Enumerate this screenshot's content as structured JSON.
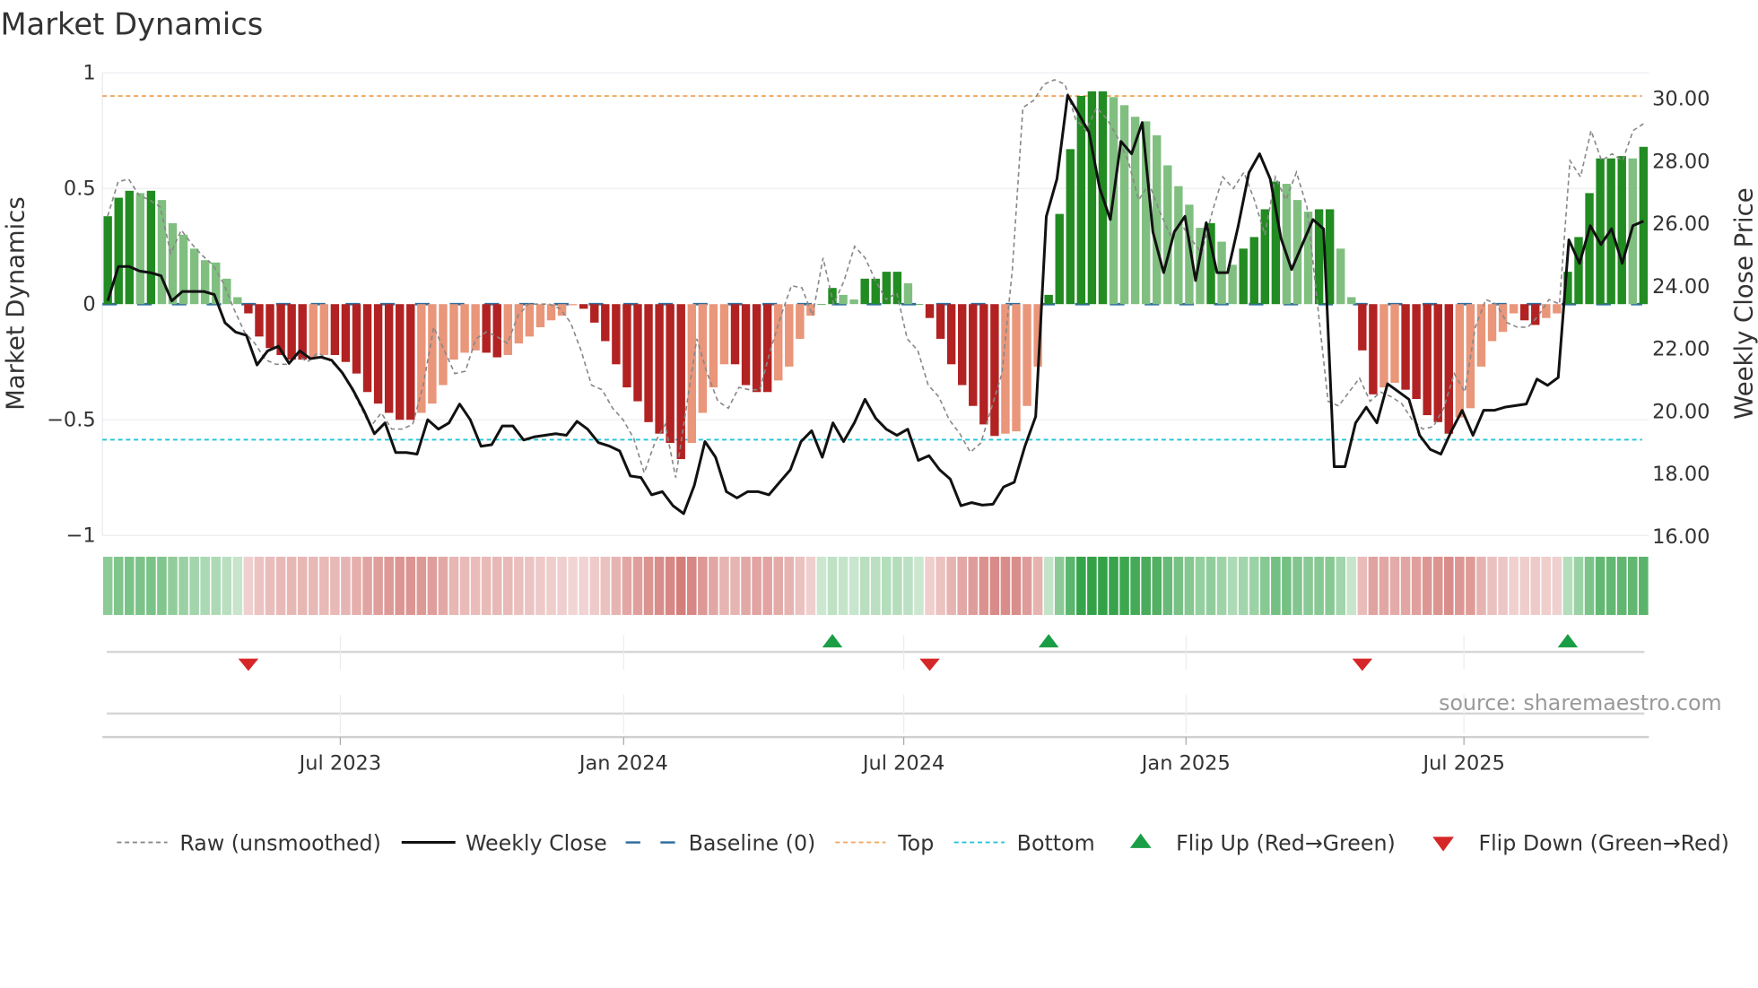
{
  "chart_data": {
    "type": "bar",
    "title": "Market Dynamics",
    "ylabel": "Market Dynamics",
    "y2label": "Weekly Close Price",
    "ylim": [
      -1,
      1
    ],
    "y2lim": [
      16,
      30.79
    ],
    "yticks": [
      {
        "v": 1,
        "label": "1"
      },
      {
        "v": 0.5,
        "label": "0.5"
      },
      {
        "v": 0,
        "label": "0"
      },
      {
        "v": -0.5,
        "label": "−0.5"
      },
      {
        "v": -1,
        "label": "−1"
      }
    ],
    "y2ticks": [
      {
        "v": 30,
        "label": "30.00"
      },
      {
        "v": 28,
        "label": "28.00"
      },
      {
        "v": 26,
        "label": "26.00"
      },
      {
        "v": 24,
        "label": "24.00"
      },
      {
        "v": 22,
        "label": "22.00"
      },
      {
        "v": 20,
        "label": "20.00"
      },
      {
        "v": 18,
        "label": "18.00"
      },
      {
        "v": 16,
        "label": "16.00"
      }
    ],
    "xticks": [
      {
        "week": 21.5,
        "label": "Jul 2023"
      },
      {
        "week": 47.7,
        "label": "Jan 2024"
      },
      {
        "week": 73.6,
        "label": "Jul 2024"
      },
      {
        "week": 99.7,
        "label": "Jan 2025"
      },
      {
        "week": 125.4,
        "label": "Jul 2025"
      }
    ],
    "top_level": 0.9,
    "bottom_level": -0.586,
    "baseline": 0,
    "market_dynamics": [
      0.38,
      0.46,
      0.49,
      0.48,
      0.49,
      0.45,
      0.35,
      0.3,
      0.24,
      0.19,
      0.18,
      0.11,
      0.03,
      -0.04,
      -0.14,
      -0.19,
      -0.22,
      -0.24,
      -0.24,
      -0.23,
      -0.22,
      -0.22,
      -0.25,
      -0.3,
      -0.38,
      -0.43,
      -0.47,
      -0.5,
      -0.5,
      -0.47,
      -0.43,
      -0.35,
      -0.24,
      -0.21,
      -0.2,
      -0.21,
      -0.23,
      -0.22,
      -0.17,
      -0.14,
      -0.1,
      -0.07,
      -0.05,
      -0.005,
      -0.02,
      -0.08,
      -0.16,
      -0.26,
      -0.36,
      -0.42,
      -0.51,
      -0.56,
      -0.6,
      -0.67,
      -0.6,
      -0.47,
      -0.36,
      -0.26,
      -0.26,
      -0.35,
      -0.38,
      -0.38,
      -0.33,
      -0.27,
      -0.15,
      -0.05,
      0.0,
      0.07,
      0.04,
      0.02,
      0.11,
      0.11,
      0.14,
      0.14,
      0.09,
      0.0,
      -0.06,
      -0.15,
      -0.26,
      -0.35,
      -0.44,
      -0.52,
      -0.57,
      -0.56,
      -0.55,
      -0.44,
      -0.27,
      0.04,
      0.39,
      0.67,
      0.9,
      0.92,
      0.92,
      0.895,
      0.86,
      0.81,
      0.79,
      0.73,
      0.6,
      0.51,
      0.43,
      0.33,
      0.35,
      0.27,
      0.17,
      0.24,
      0.29,
      0.41,
      0.53,
      0.52,
      0.45,
      0.4,
      0.41,
      0.41,
      0.24,
      0.03,
      -0.2,
      -0.39,
      -0.36,
      -0.34,
      -0.37,
      -0.41,
      -0.48,
      -0.51,
      -0.56,
      -0.49,
      -0.45,
      -0.27,
      -0.16,
      -0.12,
      -0.04,
      -0.07,
      -0.09,
      -0.06,
      -0.04,
      0.14,
      0.29,
      0.48,
      0.63,
      0.63,
      0.64,
      0.63,
      0.68
    ],
    "raw_unsmoothed": [
      0.38,
      0.53,
      0.54,
      0.47,
      0.45,
      0.42,
      0.22,
      0.32,
      0.26,
      0.21,
      0.17,
      0.09,
      -0.02,
      -0.12,
      -0.17,
      -0.24,
      -0.26,
      -0.26,
      -0.22,
      -0.25,
      -0.21,
      -0.24,
      -0.28,
      -0.35,
      -0.44,
      -0.53,
      -0.47,
      -0.54,
      -0.54,
      -0.52,
      -0.35,
      -0.1,
      -0.2,
      -0.3,
      -0.29,
      -0.15,
      -0.12,
      -0.14,
      -0.17,
      -0.05,
      0.0,
      0.0,
      0.0,
      -0.02,
      -0.08,
      -0.2,
      -0.35,
      -0.37,
      -0.45,
      -0.5,
      -0.58,
      -0.73,
      -0.6,
      -0.52,
      -0.75,
      -0.45,
      -0.15,
      -0.3,
      -0.42,
      -0.45,
      -0.36,
      -0.37,
      -0.37,
      -0.2,
      -0.05,
      0.08,
      0.07,
      -0.05,
      0.2,
      0.0,
      0.1,
      0.25,
      0.2,
      0.1,
      0.02,
      0.05,
      -0.15,
      -0.2,
      -0.35,
      -0.4,
      -0.5,
      -0.56,
      -0.64,
      -0.6,
      -0.45,
      -0.3,
      0.15,
      0.85,
      0.88,
      0.95,
      0.97,
      0.95,
      0.8,
      0.75,
      0.85,
      0.8,
      0.72,
      0.62,
      0.45,
      0.52,
      0.4,
      0.3,
      0.35,
      0.28,
      0.22,
      0.4,
      0.55,
      0.5,
      0.57,
      0.45,
      0.3,
      0.55,
      0.45,
      0.57,
      0.42,
      0.0,
      -0.42,
      -0.44,
      -0.38,
      -0.32,
      -0.42,
      -0.38,
      -0.4,
      -0.43,
      -0.5,
      -0.54,
      -0.53,
      -0.45,
      -0.3,
      -0.38,
      -0.1,
      0.02,
      0.0,
      -0.08,
      -0.1,
      -0.1,
      -0.05,
      0.02,
      0.0,
      0.62,
      0.55,
      0.75,
      0.62,
      0.65,
      0.62,
      0.75,
      0.78
    ],
    "weekly_close": [
      23.5,
      24.6,
      24.6,
      24.45,
      24.4,
      24.3,
      23.5,
      23.8,
      23.8,
      23.8,
      23.7,
      22.8,
      22.5,
      22.4,
      21.45,
      21.9,
      22.05,
      21.5,
      21.9,
      21.65,
      21.7,
      21.6,
      21.2,
      20.65,
      20.0,
      19.25,
      19.6,
      18.65,
      18.65,
      18.6,
      19.7,
      19.4,
      19.6,
      20.2,
      19.7,
      18.85,
      18.9,
      19.5,
      19.5,
      19.05,
      19.15,
      19.2,
      19.25,
      19.2,
      19.65,
      19.4,
      18.97,
      18.86,
      18.7,
      17.9,
      17.85,
      17.3,
      17.4,
      16.95,
      16.7,
      17.6,
      19.0,
      18.5,
      17.4,
      17.2,
      17.4,
      17.4,
      17.3,
      17.7,
      18.1,
      19.0,
      19.35,
      18.5,
      19.6,
      19.0,
      19.6,
      20.35,
      19.75,
      19.4,
      19.2,
      19.4,
      18.4,
      18.55,
      18.1,
      17.8,
      16.95,
      17.05,
      16.97,
      17.0,
      17.55,
      17.7,
      18.85,
      19.8,
      26.2,
      27.4,
      30.07,
      29.5,
      28.9,
      27.1,
      26.1,
      28.6,
      28.2,
      29.2,
      25.7,
      24.4,
      25.7,
      26.2,
      24.15,
      26.0,
      24.4,
      24.4,
      25.9,
      27.6,
      28.2,
      27.4,
      25.5,
      24.5,
      25.3,
      26.1,
      25.8,
      18.2,
      18.2,
      19.6,
      20.1,
      19.6,
      20.85,
      20.6,
      20.35,
      19.2,
      18.75,
      18.6,
      19.35,
      20.0,
      19.2,
      20.0,
      20.0,
      20.1,
      20.15,
      20.2,
      21.0,
      20.8,
      21.05,
      25.45,
      24.7,
      25.9,
      25.3,
      25.8,
      24.7,
      25.9,
      26.05
    ],
    "legend": [
      {
        "key": "raw",
        "label": "Raw (unsmoothed)"
      },
      {
        "key": "close",
        "label": "Weekly Close"
      },
      {
        "key": "baseline",
        "label": "Baseline (0)"
      },
      {
        "key": "top",
        "label": "Top"
      },
      {
        "key": "bottom",
        "label": "Bottom"
      },
      {
        "key": "flip_up",
        "label": "Flip Up (Red→Green)"
      },
      {
        "key": "flip_down",
        "label": "Flip Down (Green→Red)"
      }
    ],
    "legend_position": "bottom",
    "source": "source: sharemaestro.com",
    "colors": {
      "green_dark": "#228b22",
      "green_light": "#80bf80",
      "red_dark": "#b22222",
      "red_light": "#e9967a",
      "raw": "#888888",
      "close": "#111111",
      "baseline": "#2e6e9e",
      "top": "#f0a860",
      "bottom": "#22c4d6",
      "flip_up": "#1a9e45",
      "flip_down": "#d62728"
    }
  }
}
